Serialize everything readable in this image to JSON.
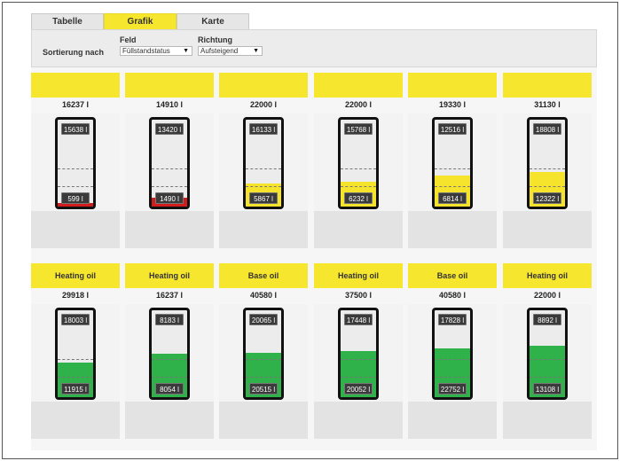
{
  "tabs": [
    {
      "label": "Tabelle",
      "active": false
    },
    {
      "label": "Grafik",
      "active": true
    },
    {
      "label": "Karte",
      "active": false
    }
  ],
  "sort": {
    "label": "Sortierung nach",
    "field": {
      "label": "Feld",
      "value": "Füllstandstatus"
    },
    "direction": {
      "label": "Richtung",
      "value": "Aufsteigend"
    }
  },
  "colors": {
    "accent": "#f7e62e",
    "red": "#d41b1b",
    "yellow": "#f6e42c",
    "green": "#2fb24a"
  },
  "tanks": [
    {
      "product": "",
      "capacity": "16237 l",
      "free": "15638 l",
      "content": "599 l",
      "level": 0.037,
      "status": "red"
    },
    {
      "product": "",
      "capacity": "14910 l",
      "free": "13420 l",
      "content": "1490 l",
      "level": 0.1,
      "status": "red"
    },
    {
      "product": "",
      "capacity": "22000 l",
      "free": "16133 l",
      "content": "5867 l",
      "level": 0.267,
      "status": "yellow"
    },
    {
      "product": "",
      "capacity": "22000 l",
      "free": "15768 l",
      "content": "6232 l",
      "level": 0.283,
      "status": "yellow"
    },
    {
      "product": "",
      "capacity": "19330 l",
      "free": "12516 l",
      "content": "6814 l",
      "level": 0.353,
      "status": "yellow"
    },
    {
      "product": "",
      "capacity": "31130 l",
      "free": "18808 l",
      "content": "12322 l",
      "level": 0.396,
      "status": "yellow"
    },
    {
      "product": "Heating oil",
      "capacity": "29918 l",
      "free": "18003 l",
      "content": "11915 l",
      "level": 0.398,
      "status": "green"
    },
    {
      "product": "Heating oil",
      "capacity": "16237 l",
      "free": "8183 l",
      "content": "8054 l",
      "level": 0.496,
      "status": "green"
    },
    {
      "product": "Base oil",
      "capacity": "40580 l",
      "free": "20065 l",
      "content": "20515 l",
      "level": 0.506,
      "status": "green"
    },
    {
      "product": "Heating oil",
      "capacity": "37500 l",
      "free": "17448 l",
      "content": "20052 l",
      "level": 0.535,
      "status": "green"
    },
    {
      "product": "Base oil",
      "capacity": "40580 l",
      "free": "17828 l",
      "content": "22752 l",
      "level": 0.561,
      "status": "green"
    },
    {
      "product": "Heating oil",
      "capacity": "22000 l",
      "free": "8892 l",
      "content": "13108 l",
      "level": 0.596,
      "status": "green"
    }
  ]
}
